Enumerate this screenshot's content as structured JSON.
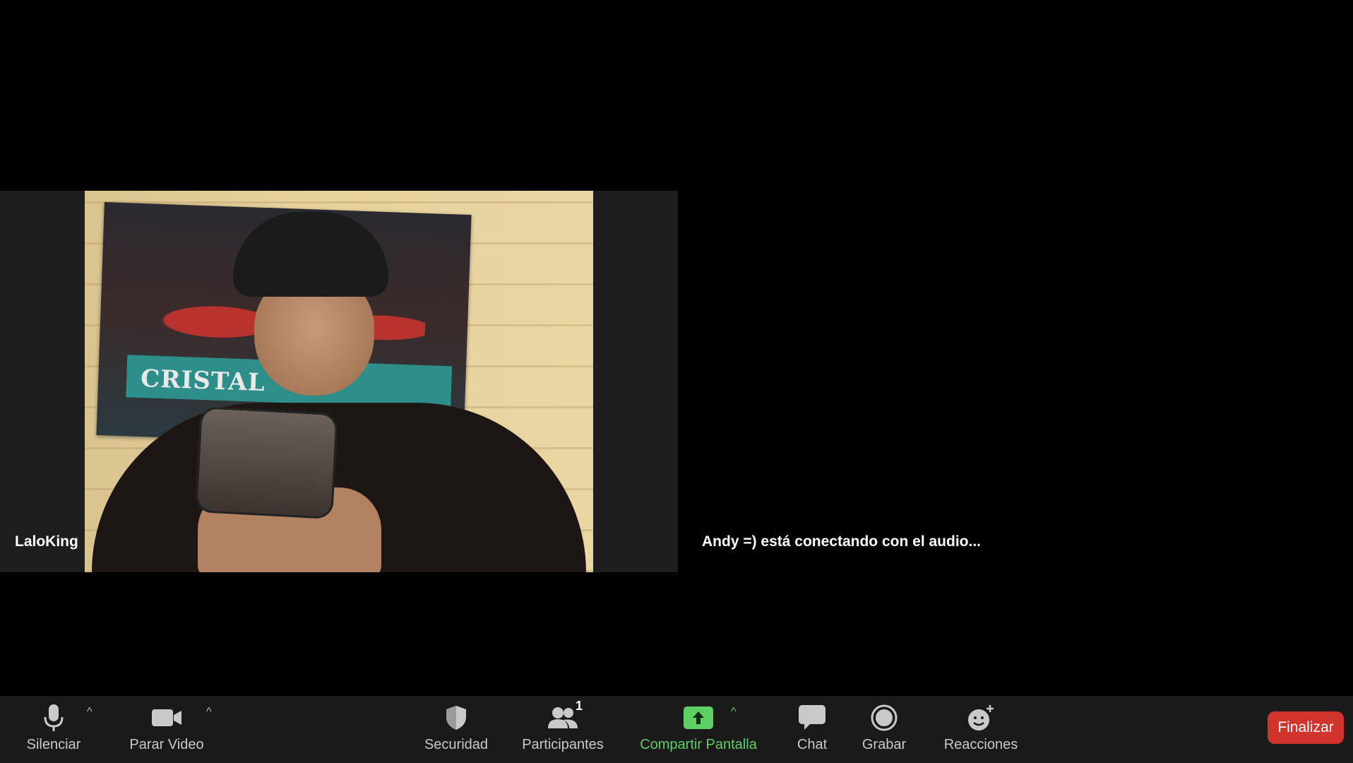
{
  "participants": [
    {
      "name": "LaloKing"
    },
    {
      "status": "Andy =) está conectando con el audio..."
    }
  ],
  "video": {
    "poster_text": "CRISTAL"
  },
  "toolbar": {
    "mute_label": "Silenciar",
    "video_label": "Parar Video",
    "security_label": "Securidad",
    "participants_label": "Participantes",
    "participants_count": "1",
    "share_label": "Compartir Pantalla",
    "chat_label": "Chat",
    "record_label": "Grabar",
    "reactions_label": "Reacciones",
    "end_label": "Finalizar"
  },
  "colors": {
    "toolbar_bg": "#1a1a1a",
    "share_accent": "#5ecf63",
    "end_button": "#d0342c"
  },
  "icons": [
    "microphone-icon",
    "video-camera-icon",
    "shield-icon",
    "participants-icon",
    "share-screen-icon",
    "chat-bubble-icon",
    "record-icon",
    "reactions-icon",
    "chevron-up-icon"
  ]
}
